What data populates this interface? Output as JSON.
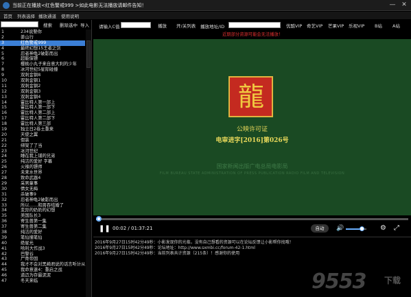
{
  "window": {
    "title": "当前正在播放<红色警戒999 >如此电影无法播放请邮件告知！",
    "minimize": "—",
    "close": "✕"
  },
  "menu": [
    "首页",
    "列表选择",
    "播放通道",
    "使用说明"
  ],
  "left_toolbar": {
    "search_value": "",
    "search_button": "搜索",
    "delete_button": "删除选中",
    "import_button": "导入"
  },
  "playlist": [
    {
      "num": "1",
      "name": "234说娶你"
    },
    {
      "num": "2",
      "name": "姜山行"
    },
    {
      "num": "3",
      "name": "红色警戒999"
    },
    {
      "num": "4",
      "name": "最终幻想15王者之剑"
    },
    {
      "num": "5",
      "name": "忍者神龟2破影而出"
    },
    {
      "num": "6",
      "name": "超能保镖"
    },
    {
      "num": "7",
      "name": "樱桃小丸子来自意大利的少年"
    },
    {
      "num": "8",
      "name": "冰河世纪5星际碰撞"
    },
    {
      "num": "9",
      "name": "双刺金钢8"
    },
    {
      "num": "10",
      "name": "双刺金钢1"
    },
    {
      "num": "11",
      "name": "双刺金钢2"
    },
    {
      "num": "12",
      "name": "双刺金钢3"
    },
    {
      "num": "13",
      "name": "双刺金钢4"
    },
    {
      "num": "14",
      "name": "霍比特人第一部上"
    },
    {
      "num": "15",
      "name": "霍比特人第一部下"
    },
    {
      "num": "16",
      "name": "霍比特人第二部上"
    },
    {
      "num": "17",
      "name": "霍比特人第二部下"
    },
    {
      "num": "18",
      "name": "霍比特人第三部"
    },
    {
      "num": "19",
      "name": "独立日2卷土重来"
    },
    {
      "num": "20",
      "name": "天使之翼"
    },
    {
      "num": "21",
      "name": "假装"
    },
    {
      "num": "22",
      "name": "绑架了了当"
    },
    {
      "num": "23",
      "name": "冰河世纪"
    },
    {
      "num": "24",
      "name": "睡在我上铺的兄弟"
    },
    {
      "num": "25",
      "name": "纯洁的爱好 字幕"
    },
    {
      "num": "26",
      "name": "火辣的镖师"
    },
    {
      "num": "27",
      "name": "未来水世界"
    },
    {
      "num": "28",
      "name": "致命武器4"
    },
    {
      "num": "29",
      "name": "采男童事"
    },
    {
      "num": "30",
      "name": "倩女无梅"
    },
    {
      "num": "31",
      "name": "杀破事9"
    },
    {
      "num": "32",
      "name": "忍者神龟2破影而出"
    },
    {
      "num": "33",
      "name": "所以……和周吞结婚了"
    },
    {
      "num": "34",
      "name": "变异的奶奶的幻想"
    },
    {
      "num": "35",
      "name": "美国队长3"
    },
    {
      "num": "36",
      "name": "寄生兽第一集"
    },
    {
      "num": "37",
      "name": "寄生兽第二集"
    },
    {
      "num": "38",
      "name": "纯洁的爱好"
    },
    {
      "num": "39",
      "name": "笔仙撞笔仙"
    },
    {
      "num": "40",
      "name": "绝星光"
    },
    {
      "num": "41",
      "name": "哈利大作战3"
    },
    {
      "num": "42",
      "name": "巴黎谷"
    },
    {
      "num": "43",
      "name": "尸骨帝国"
    },
    {
      "num": "44",
      "name": "我才不会对黑崎君说的话言听计从"
    },
    {
      "num": "45",
      "name": "我命意速4：重启之战"
    },
    {
      "num": "46",
      "name": "道迈为存最泥泥"
    },
    {
      "num": "47",
      "name": "冬天来临"
    }
  ],
  "selected_index": 2,
  "right_toolbar": {
    "input_label": "请输入C值",
    "input_value": "",
    "parse_button": "播放",
    "toggle_button": "开/关列表",
    "address_label": "播放地址/ID",
    "address_value": "",
    "channels": [
      "优酷VIP",
      "奇艺VIP",
      "芒果VIP",
      "乐视VIP",
      "B站",
      "A站"
    ],
    "warning": "近期部分资源可能会无法播放！"
  },
  "video": {
    "cert_title": "公映许可证",
    "cert_number": "电审进字[2016]第026号",
    "agency_cn": "国家新闻出版广电总局电影局",
    "agency_en": "FILM BUREAU STATE ADMINISTRATION OF PRESS PUBLICATION RADIO FILM AND TELEVISION"
  },
  "player": {
    "time_current": "00:02",
    "time_sep": " / ",
    "time_total": "01:37:21",
    "progress_fraction": 0.0003,
    "auto_label": "自动",
    "volume_fraction": 0.75
  },
  "logs": [
    "2016年9月27日15时42分49秒：小影发现你的光临，没有自己想看的资源可以在论坛反馈让小影帮你找哦！",
    "2016年9月27日15时42分49秒：论坛地址：http://www.sxmbi.cc/forum-42-1.html",
    "2016年9月27日15时42分49秒：当前列表共计资源（215条）！感谢你的使用"
  ],
  "watermark": {
    "main": "9553",
    "sub": "下载"
  }
}
